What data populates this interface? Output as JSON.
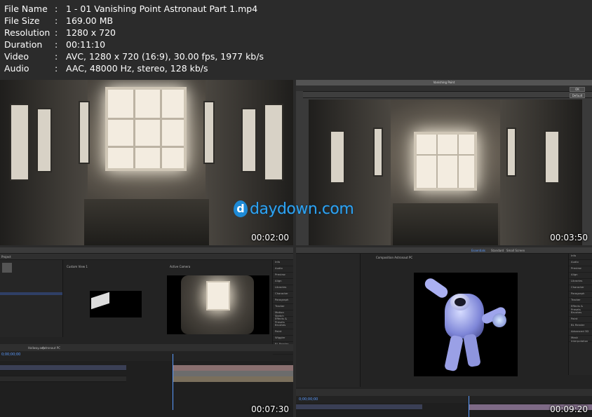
{
  "info": {
    "rows": [
      {
        "key": "File Name",
        "value": "1 - 01 Vanishing Point Astronaut Part 1.mp4"
      },
      {
        "key": "File Size",
        "value": "169.00 MB"
      },
      {
        "key": "Resolution",
        "value": "1280 x 720"
      },
      {
        "key": "Duration",
        "value": "00:11:10"
      },
      {
        "key": "Video",
        "value": "AVC, 1280 x 720 (16:9), 30.00 fps, 1977 kb/s"
      },
      {
        "key": "Audio",
        "value": "AAC, 48000 Hz, stereo, 128 kb/s"
      }
    ],
    "sep": ":"
  },
  "thumbs": {
    "t1": {
      "timestamp": "00:02:00"
    },
    "t2": {
      "timestamp": "00:03:50",
      "dialog_title": "Vanishing Point",
      "ok": "OK",
      "default": "Default"
    },
    "t3": {
      "timestamp": "00:07:30",
      "project": "Project",
      "custom_view": "Custom View 1",
      "active_camera": "Active Camera",
      "tabs": [
        "Hallway.aep",
        "Astronaut PC"
      ],
      "timecode": "0;00;00;00",
      "right_panel": [
        "Info",
        "Audio",
        "Preview",
        "Align",
        "Libraries",
        "Character",
        "Paragraph",
        "Tracker",
        "Motion Sketch",
        "Effects & Presets",
        "Brushes",
        "Paint",
        "Wiggler",
        "BL Render",
        "Advanced 3D"
      ]
    },
    "t4": {
      "timestamp": "00:09:20",
      "composition": "Composition Astronaut PC",
      "workspace": [
        "Essentials",
        "Standard",
        "Small Screen"
      ],
      "timecode": "0;00;00;00",
      "right_panel": [
        "Info",
        "Audio",
        "Preview",
        "Align",
        "Libraries",
        "Character",
        "Paragraph",
        "Tracker",
        "Effects & Presets",
        "Brushes",
        "Paint",
        "BL Render",
        "Advanced 3D",
        "Mask Interpolation"
      ]
    }
  },
  "watermark": {
    "letter": "d",
    "text": "daydown.com"
  },
  "colors": {
    "accent": "#2ea3f2",
    "ae_blue": "#5b9bff"
  }
}
